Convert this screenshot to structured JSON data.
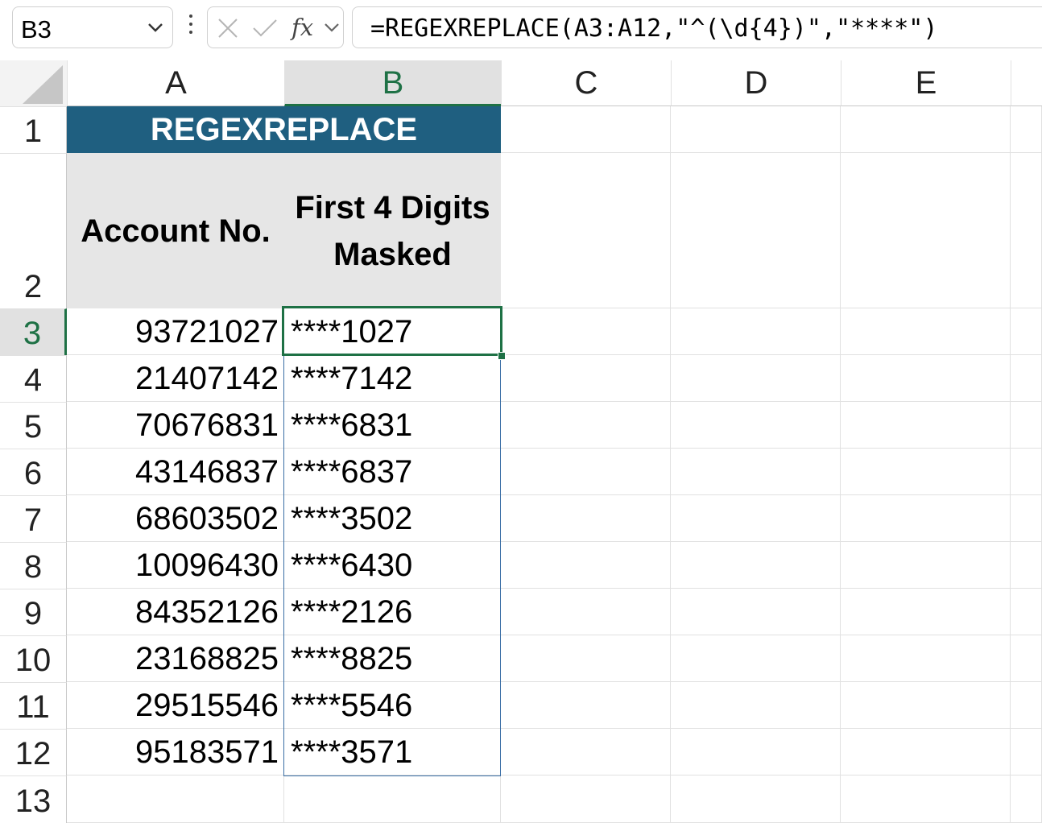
{
  "formula_bar": {
    "name_box": "B3",
    "fx_label": "fx",
    "formula": "=REGEXREPLACE(A3:A12,\"^(\\d{4})\",\"****\")"
  },
  "columns": [
    "A",
    "B",
    "C",
    "D",
    "E"
  ],
  "rows": [
    "1",
    "2",
    "3",
    "4",
    "5",
    "6",
    "7",
    "8",
    "9",
    "10",
    "11",
    "12",
    "13"
  ],
  "sheet": {
    "title": "REGEXREPLACE",
    "header_a": "Account No.",
    "header_b_line1": "First 4 Digits",
    "header_b_line2": "Masked",
    "data": [
      {
        "account": "93721027",
        "masked": "****1027"
      },
      {
        "account": "21407142",
        "masked": "****7142"
      },
      {
        "account": "70676831",
        "masked": "****6831"
      },
      {
        "account": "43146837",
        "masked": "****6837"
      },
      {
        "account": "68603502",
        "masked": "****3502"
      },
      {
        "account": "10096430",
        "masked": "****6430"
      },
      {
        "account": "84352126",
        "masked": "****2126"
      },
      {
        "account": "23168825",
        "masked": "****8825"
      },
      {
        "account": "29515546",
        "masked": "****5546"
      },
      {
        "account": "95183571",
        "masked": "****3571"
      }
    ]
  },
  "selection": {
    "active_cell": "B3",
    "spill_range": "B3:B12"
  },
  "colors": {
    "title_fill": "#1f5f80",
    "header_fill": "#e6e6e6",
    "selection_accent": "#1e7145",
    "spill_border": "#3a6ea5"
  }
}
